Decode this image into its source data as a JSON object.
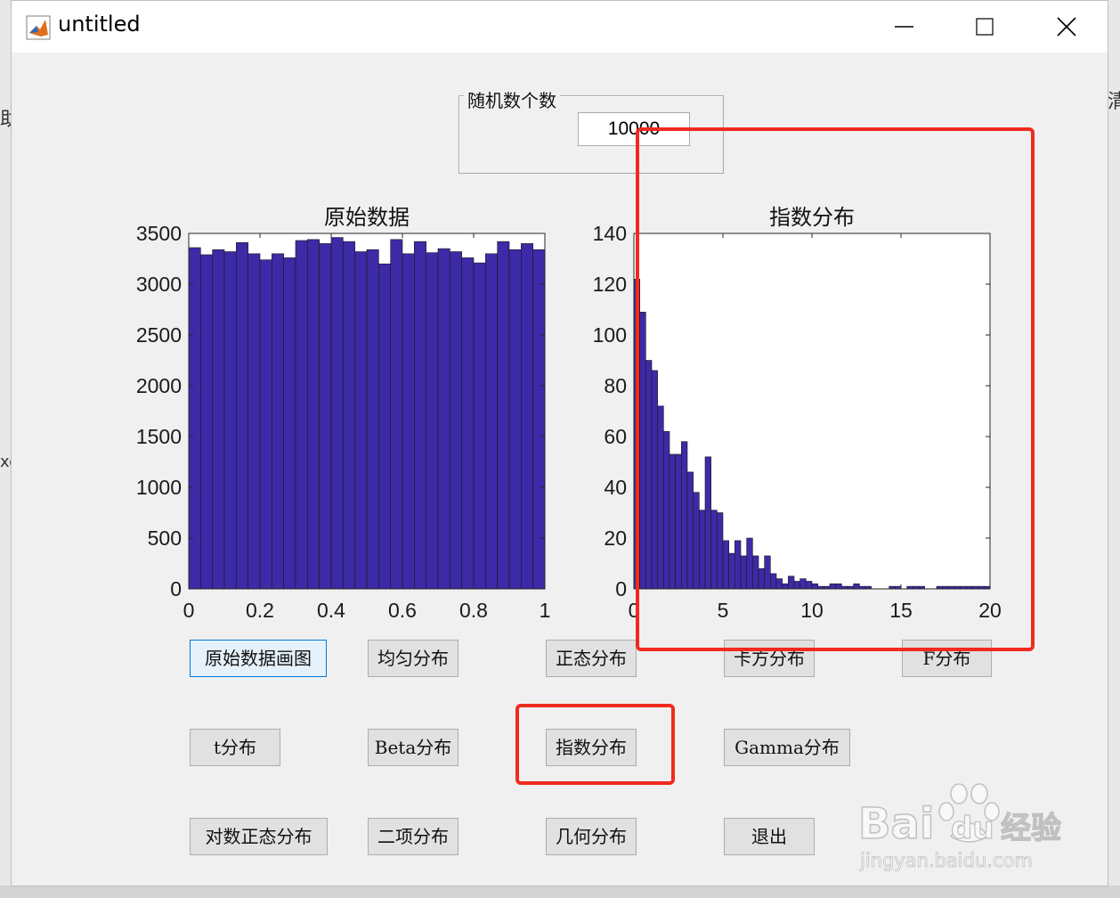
{
  "window": {
    "title": "untitled"
  },
  "panel": {
    "title": "随机数个数",
    "count_value": "10000"
  },
  "charts": [
    {
      "title": "原始数据",
      "type": "bar",
      "xlim": [
        0,
        1
      ],
      "ylim": [
        0,
        3500
      ],
      "x_ticks": [
        "0",
        "0.2",
        "0.4",
        "0.6",
        "0.8",
        "1"
      ],
      "y_ticks": [
        "0",
        "500",
        "1000",
        "1500",
        "2000",
        "2500",
        "3000",
        "3500"
      ],
      "bar_color": "#3d2aa6",
      "values": [
        3360,
        3290,
        3340,
        3320,
        3410,
        3300,
        3240,
        3300,
        3260,
        3430,
        3440,
        3400,
        3460,
        3420,
        3320,
        3340,
        3200,
        3440,
        3300,
        3420,
        3310,
        3350,
        3320,
        3260,
        3210,
        3300,
        3420,
        3340,
        3400,
        3340
      ]
    },
    {
      "title": "指数分布",
      "type": "bar",
      "xlim": [
        0,
        20
      ],
      "ylim": [
        0,
        140
      ],
      "x_ticks": [
        "0",
        "5",
        "10",
        "15",
        "20"
      ],
      "y_ticks": [
        "0",
        "20",
        "40",
        "60",
        "80",
        "100",
        "120",
        "140"
      ],
      "bar_color": "#3d2aa6",
      "values": [
        122,
        109,
        90,
        86,
        72,
        62,
        53,
        53,
        58,
        46,
        38,
        31,
        52,
        31,
        30,
        19,
        14,
        19,
        13,
        20,
        13,
        8,
        13,
        6,
        4,
        2,
        5,
        3,
        4,
        3,
        2,
        1,
        1,
        2,
        2,
        1,
        1,
        2,
        1,
        1,
        0,
        0,
        0,
        1,
        1,
        0,
        1,
        1,
        1,
        0,
        0,
        1,
        1,
        1,
        1,
        1,
        1,
        1,
        1,
        1
      ]
    }
  ],
  "buttons": {
    "raw_plot": "原始数据画图",
    "uniform": "均匀分布",
    "normal": "正态分布",
    "chi2": "卡方分布",
    "f": "F分布",
    "t": "t分布",
    "beta": "Beta分布",
    "exp": "指数分布",
    "gamma": "Gamma分布",
    "lognormal": "对数正态分布",
    "binomial": "二项分布",
    "geometric": "几何分布",
    "exit": "退出"
  },
  "background_fragments": {
    "left_a": "助",
    "left_b": "xe",
    "right": "清"
  },
  "watermark": {
    "brand": "Bai",
    "brand2": "du",
    "cn": "经验",
    "url": "jingyan.baidu.com"
  },
  "colors": {
    "highlight": "#f02a1e",
    "bar": "#3d2aa6",
    "focused_border": "#0078d7"
  }
}
